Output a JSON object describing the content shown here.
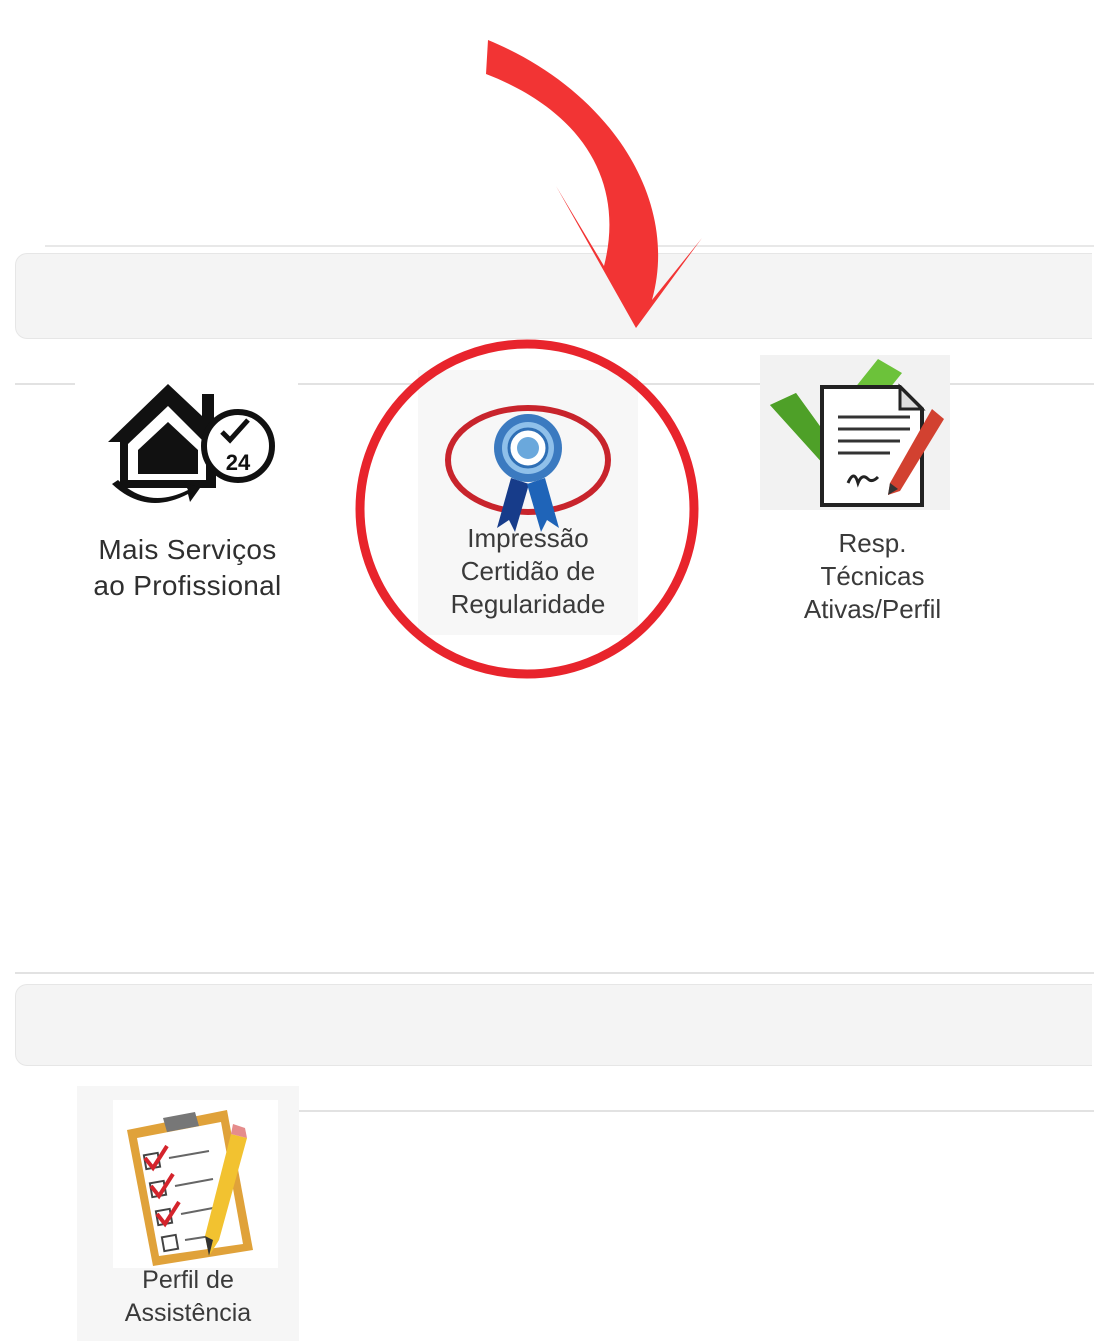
{
  "tiles": {
    "services": {
      "line1": "Mais Serviços",
      "line2": "ao Profissional",
      "icon": "home-24h-icon"
    },
    "certificate": {
      "line1": "Impressão",
      "line2": "Certidão de",
      "line3": "Regularidade",
      "icon": "rosette-ribbon-icon"
    },
    "technical": {
      "line1": "Resp.",
      "line2": "Técnicas",
      "line3": "Ativas/Perfil",
      "icon": "signed-document-check-icon"
    },
    "assistance": {
      "line1": "Perfil de",
      "line2": "Assistência",
      "icon": "clipboard-checklist-icon"
    }
  },
  "annotation": {
    "arrow_color": "#f23434",
    "circle_color": "#e8242c"
  }
}
